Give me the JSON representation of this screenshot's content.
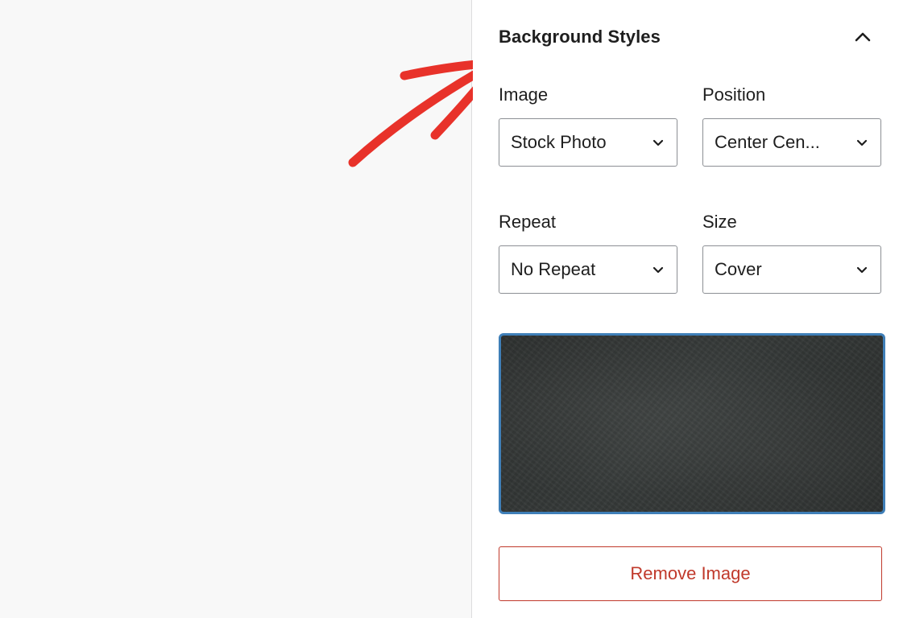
{
  "panel": {
    "section_title": "Background Styles",
    "collapse_icon": "chevron-up-icon"
  },
  "fields": {
    "image": {
      "label": "Image",
      "value": "Stock Photo"
    },
    "position": {
      "label": "Position",
      "value": "Center Cen..."
    },
    "repeat": {
      "label": "Repeat",
      "value": "No Repeat"
    },
    "size": {
      "label": "Size",
      "value": "Cover"
    }
  },
  "preview": {
    "description_icon": "dark-texture-image"
  },
  "actions": {
    "remove_label": "Remove Image"
  },
  "colors": {
    "annotation_arrow": "#e8322a",
    "remove_accent": "#c0392b",
    "preview_border": "#3f7fb8"
  }
}
